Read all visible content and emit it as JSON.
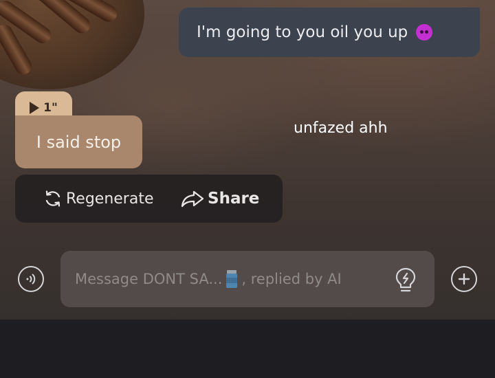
{
  "messages": [
    {
      "role": "user",
      "text": "I'm going to you oil you up",
      "emoji": "smiling-devil-emoji"
    },
    {
      "role": "ai",
      "voice_duration": "1\"",
      "text": "I said stop"
    }
  ],
  "overlay_caption": "unfazed ahh",
  "actions": {
    "regenerate": "Regenerate",
    "share": "Share"
  },
  "composer": {
    "placeholder_prefix": "Message DONT SA...",
    "placeholder_suffix": ", replied by AI"
  },
  "colors": {
    "user_bubble": "#3d424f",
    "ai_bubble": "#a8876d",
    "voice_tag": "#d9b996",
    "emoji": "#c42fd1"
  }
}
